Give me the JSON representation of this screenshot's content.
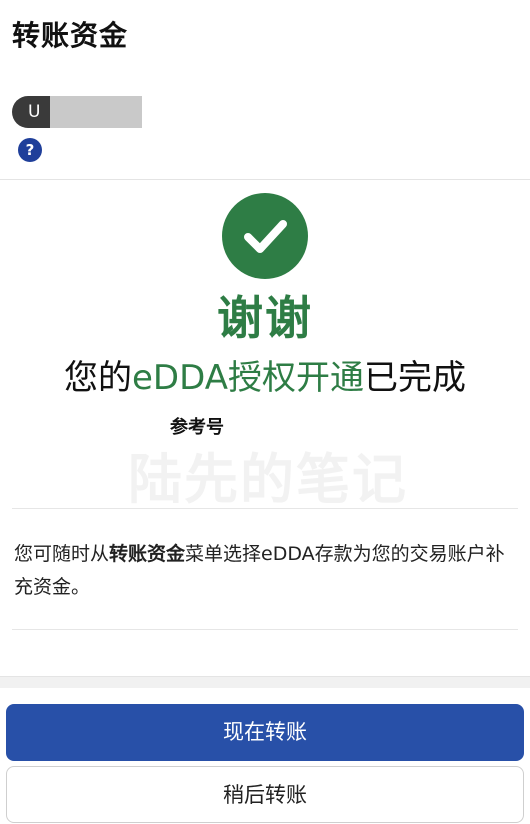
{
  "header": {
    "title": "转账资金",
    "account_prefix": "U",
    "help_icon": "?"
  },
  "success": {
    "check_icon": "check-icon",
    "thanks": "谢谢",
    "status_part1": "您的",
    "status_highlight": "eDDA授权开通",
    "status_part2": "已完成",
    "ref_label": "参考号",
    "watermark": "陆先的笔记"
  },
  "info": {
    "part1": "您可随时从",
    "bold": "转账资金",
    "part2": "菜单选择eDDA存款为您的交易账户补充资金。"
  },
  "actions": {
    "primary_label": "现在转账",
    "secondary_label": "稍后转账"
  },
  "colors": {
    "success_green": "#2e7d45",
    "primary_blue": "#2850a8",
    "help_blue": "#1f3f9a"
  }
}
